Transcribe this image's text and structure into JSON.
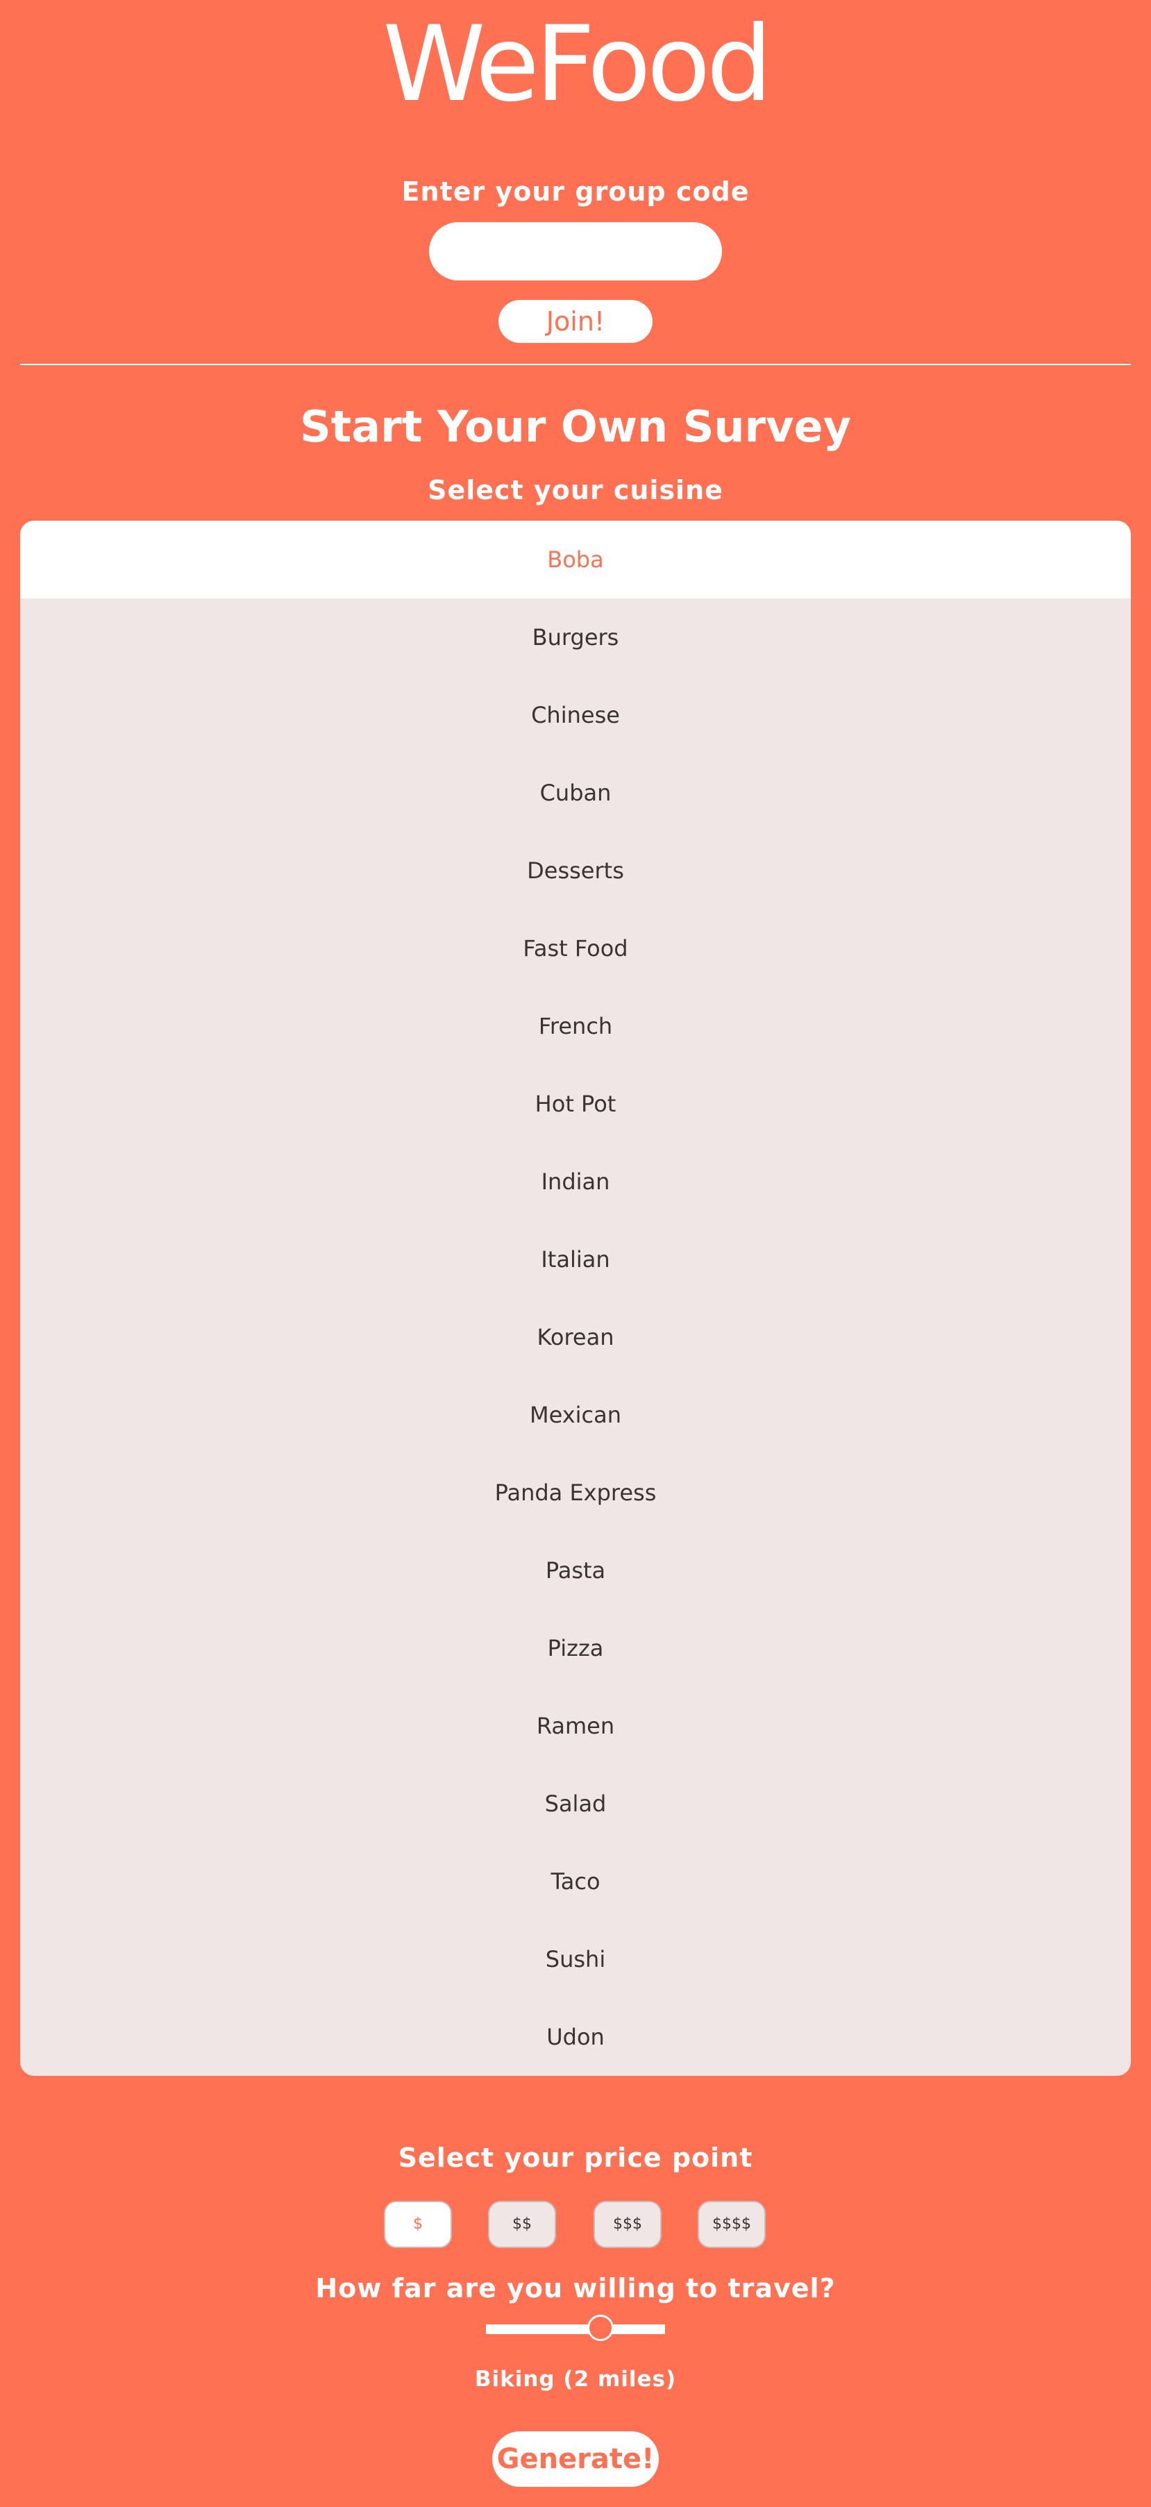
{
  "header": {
    "logo_text": "WeFood"
  },
  "join": {
    "label": "Enter your group code",
    "input_value": "",
    "input_placeholder": "",
    "button_label": "Join!"
  },
  "survey": {
    "title": "Start Your Own Survey",
    "cuisine_label": "Select your cuisine",
    "cuisines": [
      {
        "label": "Boba",
        "selected": true
      },
      {
        "label": "Burgers",
        "selected": false
      },
      {
        "label": "Chinese",
        "selected": false
      },
      {
        "label": "Cuban",
        "selected": false
      },
      {
        "label": "Desserts",
        "selected": false
      },
      {
        "label": "Fast Food",
        "selected": false
      },
      {
        "label": "French",
        "selected": false
      },
      {
        "label": "Hot Pot",
        "selected": false
      },
      {
        "label": "Indian",
        "selected": false
      },
      {
        "label": "Italian",
        "selected": false
      },
      {
        "label": "Korean",
        "selected": false
      },
      {
        "label": "Mexican",
        "selected": false
      },
      {
        "label": "Panda Express",
        "selected": false
      },
      {
        "label": "Pasta",
        "selected": false
      },
      {
        "label": "Pizza",
        "selected": false
      },
      {
        "label": "Ramen",
        "selected": false
      },
      {
        "label": "Salad",
        "selected": false
      },
      {
        "label": "Taco",
        "selected": false
      },
      {
        "label": "Sushi",
        "selected": false
      },
      {
        "label": "Udon",
        "selected": false
      }
    ],
    "price_label": "Select your price point",
    "prices": [
      {
        "label": "$",
        "selected": true
      },
      {
        "label": "$$",
        "selected": false
      },
      {
        "label": "$$$",
        "selected": false
      },
      {
        "label": "$$$$",
        "selected": false
      }
    ],
    "travel_label": "How far are you willing to travel?",
    "travel_slider_fraction": 0.64,
    "travel_value": "Biking (2 miles)",
    "generate_label": "Generate!"
  },
  "colors": {
    "background": "#FF7152",
    "accent": "#FF7152",
    "list_background": "#EFE6E5",
    "list_text": "#3A3332",
    "white": "#FFFFFF"
  }
}
